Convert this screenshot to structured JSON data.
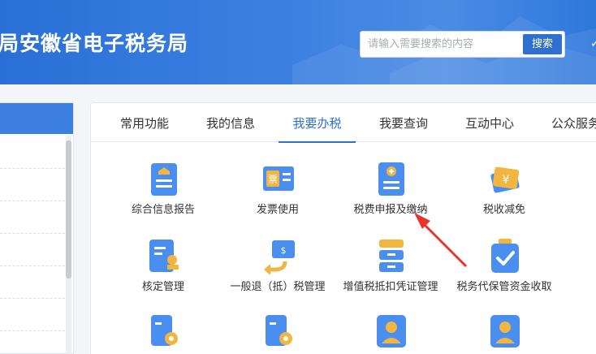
{
  "header": {
    "title": "局安徽省电子税务局",
    "search": {
      "placeholder": "请输入需要搜索的内容",
      "button": "搜索"
    }
  },
  "tabs": [
    {
      "label": "常用功能",
      "active": false
    },
    {
      "label": "我的信息",
      "active": false
    },
    {
      "label": "我要办税",
      "active": true
    },
    {
      "label": "我要查询",
      "active": false
    },
    {
      "label": "互动中心",
      "active": false
    },
    {
      "label": "公众服务",
      "active": false
    }
  ],
  "functions": {
    "row1": [
      {
        "label": "综合信息报告",
        "icon": "report-icon"
      },
      {
        "label": "发票使用",
        "icon": "invoice-icon"
      },
      {
        "label": "税费申报及缴纳",
        "icon": "tax-declare-icon"
      },
      {
        "label": "税收减免",
        "icon": "tax-relief-icon"
      }
    ],
    "row2": [
      {
        "label": "核定管理",
        "icon": "approval-icon"
      },
      {
        "label": "一般退（抵）税管理",
        "icon": "refund-icon"
      },
      {
        "label": "增值税抵扣凭证管理",
        "icon": "voucher-icon"
      },
      {
        "label": "税务代保管资金收取",
        "icon": "custody-fund-icon"
      }
    ]
  },
  "colors": {
    "brand": "#2e6fd0",
    "header": "#3b80e0",
    "annotation": "#e8342a",
    "icon_blue": "#4a8ef0"
  }
}
